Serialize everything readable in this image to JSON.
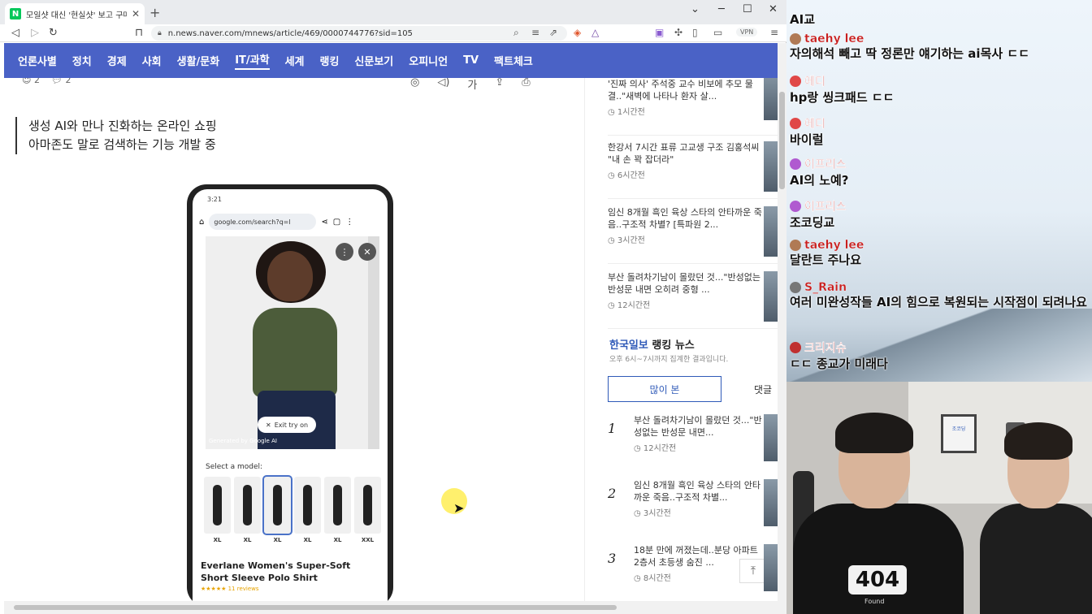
{
  "browser": {
    "tab_title": "모일샷 대신 '현실샷' 보고 구매...",
    "favicon_letter": "N",
    "url": "n.news.naver.com/mnews/article/469/0000744776?sid=105",
    "vpn_label": "VPN"
  },
  "nav": {
    "items": [
      "언론사별",
      "정치",
      "경제",
      "사회",
      "생활/문화",
      "IT/과학",
      "세계",
      "랭킹",
      "신문보기",
      "오피니언",
      "TV",
      "팩트체크"
    ],
    "active_index": 5
  },
  "article": {
    "reaction_count": "2",
    "comment_count": "2",
    "subtitle_line1": "생성 AI와 만나 진화하는 온라인 쇼핑",
    "subtitle_line2": "아마존도 말로 검색하는 기능 개발 중",
    "phone": {
      "time": "3:21",
      "url": "google.com/search?q=l",
      "exit_try_on": "Exit try on",
      "generated_by": "Generated by Google AI",
      "select_model": "Select a model:",
      "sizes": [
        "XL",
        "XL",
        "XL",
        "XL",
        "XL",
        "XXL"
      ],
      "product_name": "Everlane Women's Super-Soft Short Sleeve Polo Shirt",
      "reviews": "★★★★★ 11 reviews"
    }
  },
  "sidebar": {
    "news": [
      {
        "title": "'진짜 의사' 주석중 교수 비보에 추모 물결..\"새벽에 나타나 환자 살...",
        "time": "1시간전"
      },
      {
        "title": "한강서 7시간 표류 고교생 구조 김홍석씨 \"내 손 꽉 잡더라\"",
        "time": "6시간전"
      },
      {
        "title": "임신 8개월 흑인 육상 스타의 안타까운 죽음..구조적 차별? [특파원 2...",
        "time": "3시간전"
      },
      {
        "title": "부산 돌려차기남이 몰랐던 것...\"반성없는 반성문 내면 오히려 중형 ...",
        "time": "12시간전"
      }
    ],
    "ranking": {
      "brand": "한국일보",
      "title": "랭킹 뉴스",
      "subtitle": "오후 6시~7시까지 집계한 결과입니다.",
      "tab_most_viewed": "많이 본",
      "tab_comments": "댓글",
      "items": [
        {
          "num": "1",
          "title": "부산 돌려차기남이 몰랐던 것...\"반성없는 반성문 내면...",
          "time": "12시간전"
        },
        {
          "num": "2",
          "title": "임신 8개월 흑인 육상 스타의 안타까운 죽음..구조적 차별...",
          "time": "3시간전"
        },
        {
          "num": "3",
          "title": "18분 만에 꺼졌는데..분당 아파트 2층서 초등생 숨진 ...",
          "time": "8시간전"
        }
      ]
    }
  },
  "chat": {
    "messages": [
      {
        "user": "",
        "text": "AI교",
        "badge_color": "#3aa35a"
      },
      {
        "user": "taehy lee",
        "text": "자의해석 빼고 딱 정론만 얘기하는 ai목사 ㄷㄷ",
        "badge_color": "#b07a55"
      },
      {
        "user": "에디",
        "text": "hp랑 씽크패드 ㄷㄷ",
        "badge_color": "#e04848"
      },
      {
        "user": "에디",
        "text": "바이럴",
        "badge_color": "#e04848"
      },
      {
        "user": "이프리스",
        "text": "AI의 노예?",
        "badge_color": "#b05ad0"
      },
      {
        "user": "이프리스",
        "text": "조코딩교",
        "badge_color": "#b05ad0"
      },
      {
        "user": "taehy lee",
        "text": "달란트 주나요",
        "badge_color": "#b07a55"
      },
      {
        "user": "S_Rain",
        "text": "여러 미완성작들 AI의 힘으로 복원되는 시작점이 되려나요",
        "badge_color": "#777777"
      },
      {
        "user": "크리지슈",
        "text": "ㄷㄷ 종교가 미래다",
        "badge_color": "#c03030"
      }
    ]
  },
  "cam": {
    "shirt_logo": "404",
    "shirt_sub": "Found",
    "frame_text": "조코딩"
  }
}
